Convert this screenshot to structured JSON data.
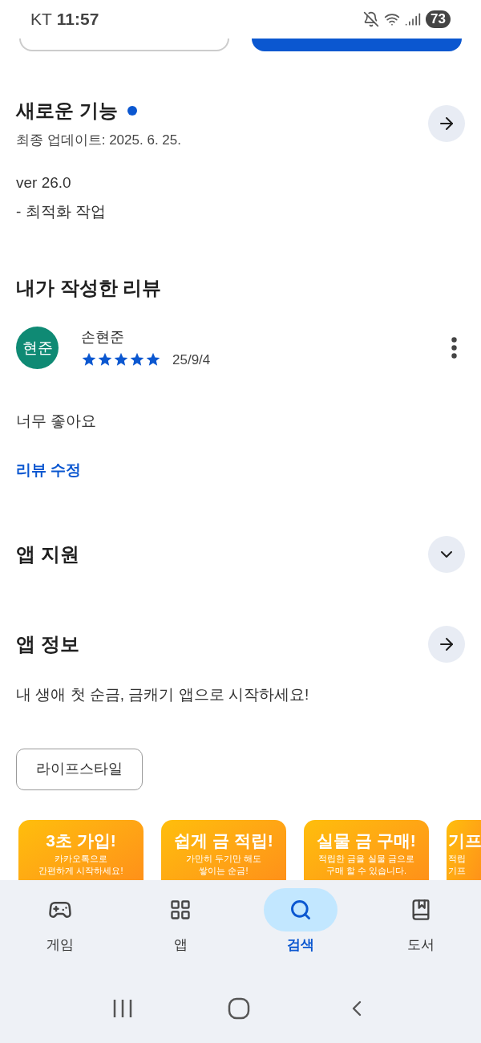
{
  "status_bar": {
    "carrier": "KT",
    "time": "11:57",
    "battery": "73"
  },
  "whats_new": {
    "title": "새로운 기능",
    "updated": "최종 업데이트: 2025. 6. 25.",
    "notes": [
      "ver 26.0",
      "- 최적화 작업"
    ]
  },
  "my_review": {
    "title": "내가 작성한 리뷰",
    "avatar": "현준",
    "author": "손현준",
    "stars": 5,
    "date": "25/9/4",
    "text": "너무 좋아요",
    "edit_link": "리뷰 수정"
  },
  "app_support": {
    "title": "앱 지원",
    "expanded": false
  },
  "app_info": {
    "title": "앱 정보",
    "description": "내 생애 첫 순금, 금캐기 앱으로 시작하세요!",
    "category": "라이프스타일"
  },
  "screenshots": [
    {
      "title": "3초 가입!",
      "lines": [
        "카카오톡으로",
        "간편하게 시작하세요!"
      ]
    },
    {
      "title": "쉽게 금 적립!",
      "lines": [
        "가만히 두기만 해도",
        "쌓이는 순금!"
      ]
    },
    {
      "title": "실물 금 구매!",
      "lines": [
        "적립한 금을 실물 금으로",
        "구매 할 수 있습니다."
      ]
    },
    {
      "title": "기프",
      "lines": [
        "적립",
        "기프"
      ]
    }
  ],
  "bottom_nav": [
    {
      "label": "게임",
      "kind": "game",
      "selected": false
    },
    {
      "label": "앱",
      "kind": "apps",
      "selected": false
    },
    {
      "label": "검색",
      "kind": "search",
      "selected": true
    },
    {
      "label": "도서",
      "kind": "book",
      "selected": false
    }
  ]
}
